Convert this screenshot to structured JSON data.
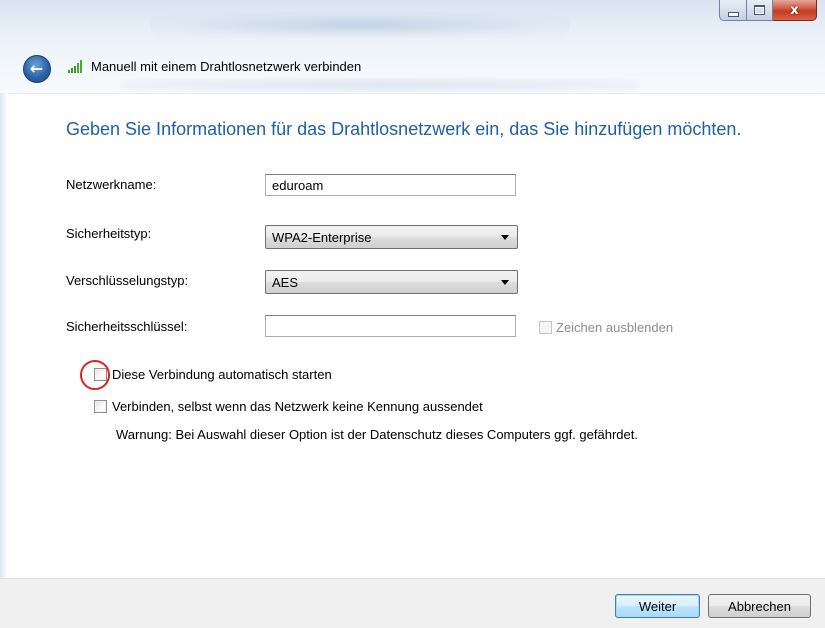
{
  "window": {
    "title": "Manuell mit einem Drahtlosnetzwerk verbinden",
    "controls": {
      "minimize": "–",
      "maximize": "□",
      "close": "x"
    }
  },
  "heading": "Geben Sie Informationen für das Drahtlosnetzwerk ein, das Sie hinzufügen möchten.",
  "form": {
    "network_name": {
      "label": "Netzwerkname:",
      "value": "eduroam"
    },
    "security_type": {
      "label": "Sicherheitstyp:",
      "selected": "WPA2-Enterprise"
    },
    "encryption_type": {
      "label": "Verschlüsselungstyp:",
      "selected": "AES"
    },
    "security_key": {
      "label": "Sicherheitsschlüssel:",
      "value": ""
    },
    "hide_characters": {
      "label": "Zeichen ausblenden",
      "checked": false,
      "enabled": false
    }
  },
  "options": {
    "auto_start": {
      "label": "Diese Verbindung automatisch starten",
      "checked": false
    },
    "connect_hidden": {
      "label": "Verbinden, selbst wenn das Netzwerk keine Kennung aussendet",
      "checked": false
    },
    "warning": "Warnung: Bei Auswahl dieser Option ist der Datenschutz dieses Computers ggf. gefährdet."
  },
  "buttons": {
    "next": "Weiter",
    "cancel": "Abbrechen"
  },
  "colors": {
    "heading": "#1f5fa8",
    "highlight_ring": "#d9261c",
    "close_button": "#c13b22"
  },
  "icons": {
    "back": "back-arrow-icon",
    "signal": "wireless-signal-icon"
  }
}
